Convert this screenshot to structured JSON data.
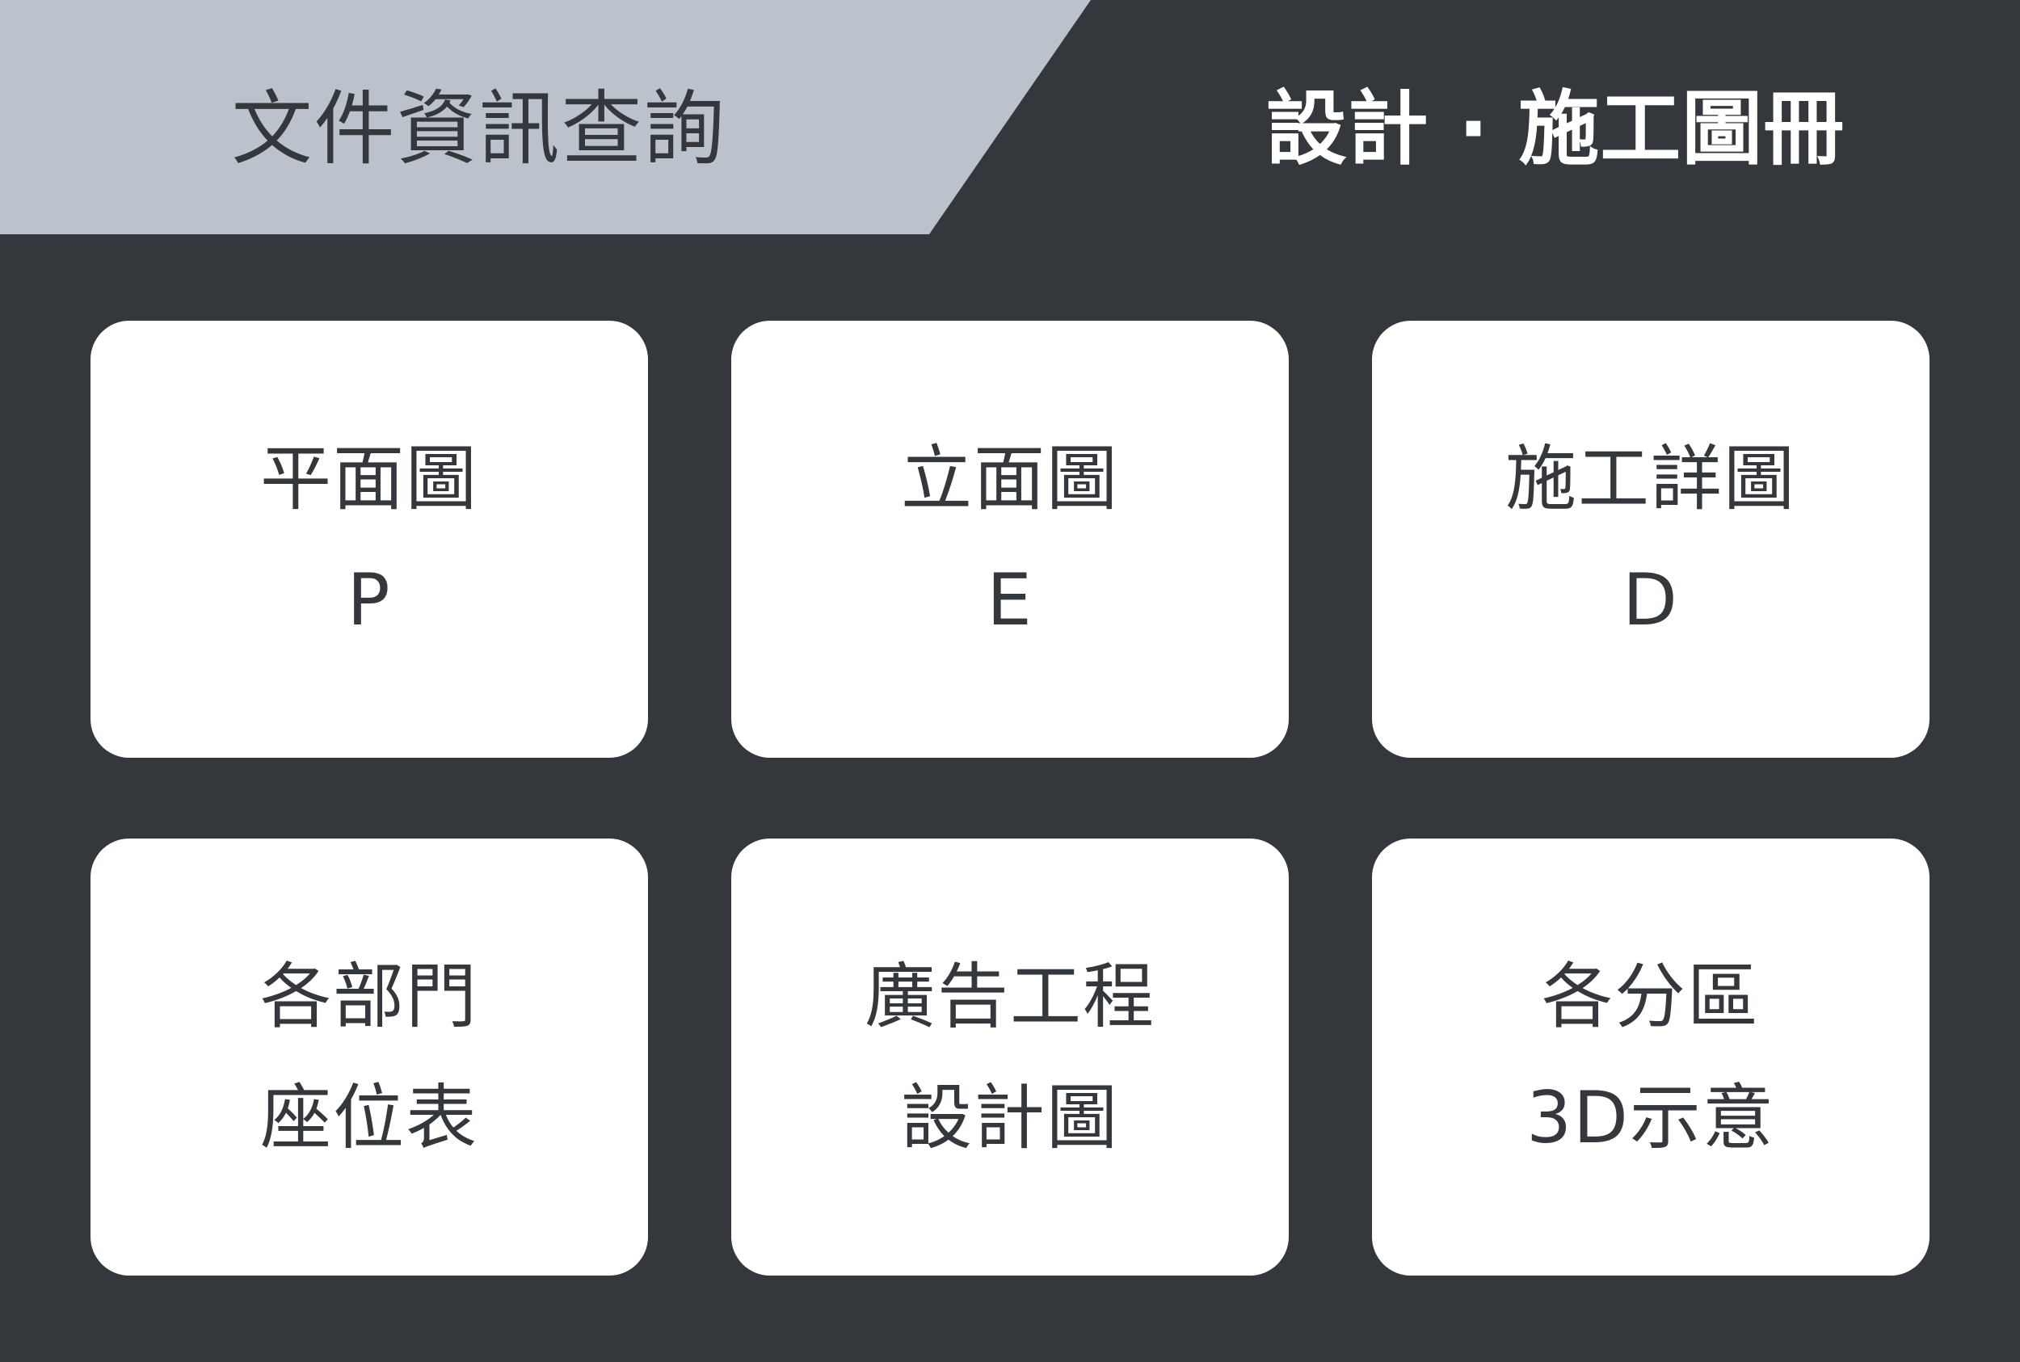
{
  "header": {
    "left_title": "文件資訊查詢",
    "right_title": "設計 · 施工圖冊"
  },
  "tiles": [
    {
      "line1": "平面圖",
      "line2": "P"
    },
    {
      "line1": "立面圖",
      "line2": "E"
    },
    {
      "line1": "施工詳圖",
      "line2": "D"
    },
    {
      "line1": "各部門",
      "line2": "座位表"
    },
    {
      "line1": "廣告工程",
      "line2": "設計圖"
    },
    {
      "line1": "各分區",
      "line2": "3D示意"
    }
  ],
  "colors": {
    "background": "#34373c",
    "header_tab": "#bcc2cb",
    "tile": "#ffffff",
    "text_dark": "#34373c",
    "text_light": "#ffffff"
  }
}
